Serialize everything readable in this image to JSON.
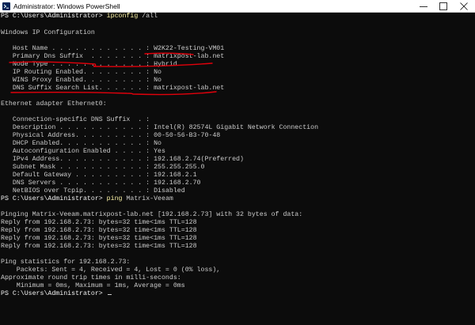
{
  "window": {
    "title": "Administrator: Windows PowerShell",
    "accent_color": "#e3000b",
    "console_background": "#0c0c0c",
    "console_text_color": "#cccccc",
    "command_color": "#f9f1a5",
    "controls": [
      "minimize-icon",
      "maximize-icon",
      "close-icon"
    ]
  },
  "console": {
    "l1_prompt": "PS C:\\Users\\Administrator> ",
    "l1_cmd": "ipconfig",
    "l1_args": " /all",
    "l3": "Windows IP Configuration",
    "l5": "   Host Name . . . . . . . . . . . . : W2K22-Testing-VM01",
    "l6": "   Primary Dns Suffix  . . . . . . . : matrixpost-lab.net",
    "l7": "   Node Type . . . . . . . . . . . . : Hybrid",
    "l8": "   IP Routing Enabled. . . . . . . . : No",
    "l9": "   WINS Proxy Enabled. . . . . . . . : No",
    "l10": "   DNS Suffix Search List. . . . . . : matrixpost-lab.net",
    "l12": "Ethernet adapter Ethernet0:",
    "l14": "   Connection-specific DNS Suffix  . :",
    "l15": "   Description . . . . . . . . . . . : Intel(R) 82574L Gigabit Network Connection",
    "l16": "   Physical Address. . . . . . . . . : 00-50-56-B3-70-48",
    "l17": "   DHCP Enabled. . . . . . . . . . . : No",
    "l18": "   Autoconfiguration Enabled . . . . : Yes",
    "l19": "   IPv4 Address. . . . . . . . . . . : 192.168.2.74(Preferred)",
    "l20": "   Subnet Mask . . . . . . . . . . . : 255.255.255.0",
    "l21": "   Default Gateway . . . . . . . . . : 192.168.2.1",
    "l22": "   DNS Servers . . . . . . . . . . . : 192.168.2.70",
    "l23": "   NetBIOS over Tcpip. . . . . . . . : Disabled",
    "l24_prompt": "PS C:\\Users\\Administrator> ",
    "l24_cmd": "ping",
    "l24_args": " Matrix-Veeam",
    "l26": "Pinging Matrix-Veeam.matrixpost-lab.net [192.168.2.73] with 32 bytes of data:",
    "l27": "Reply from 192.168.2.73: bytes=32 time<1ms TTL=128",
    "l28": "Reply from 192.168.2.73: bytes=32 time<1ms TTL=128",
    "l29": "Reply from 192.168.2.73: bytes=32 time<1ms TTL=128",
    "l30": "Reply from 192.168.2.73: bytes=32 time<1ms TTL=128",
    "l32": "Ping statistics for 192.168.2.73:",
    "l33": "    Packets: Sent = 4, Received = 4, Lost = 0 (0% loss),",
    "l34": "Approximate round trip times in milli-seconds:",
    "l35": "    Minimum = 0ms, Maximum = 1ms, Average = 0ms",
    "l36_prompt": "PS C:\\Users\\Administrator> "
  }
}
